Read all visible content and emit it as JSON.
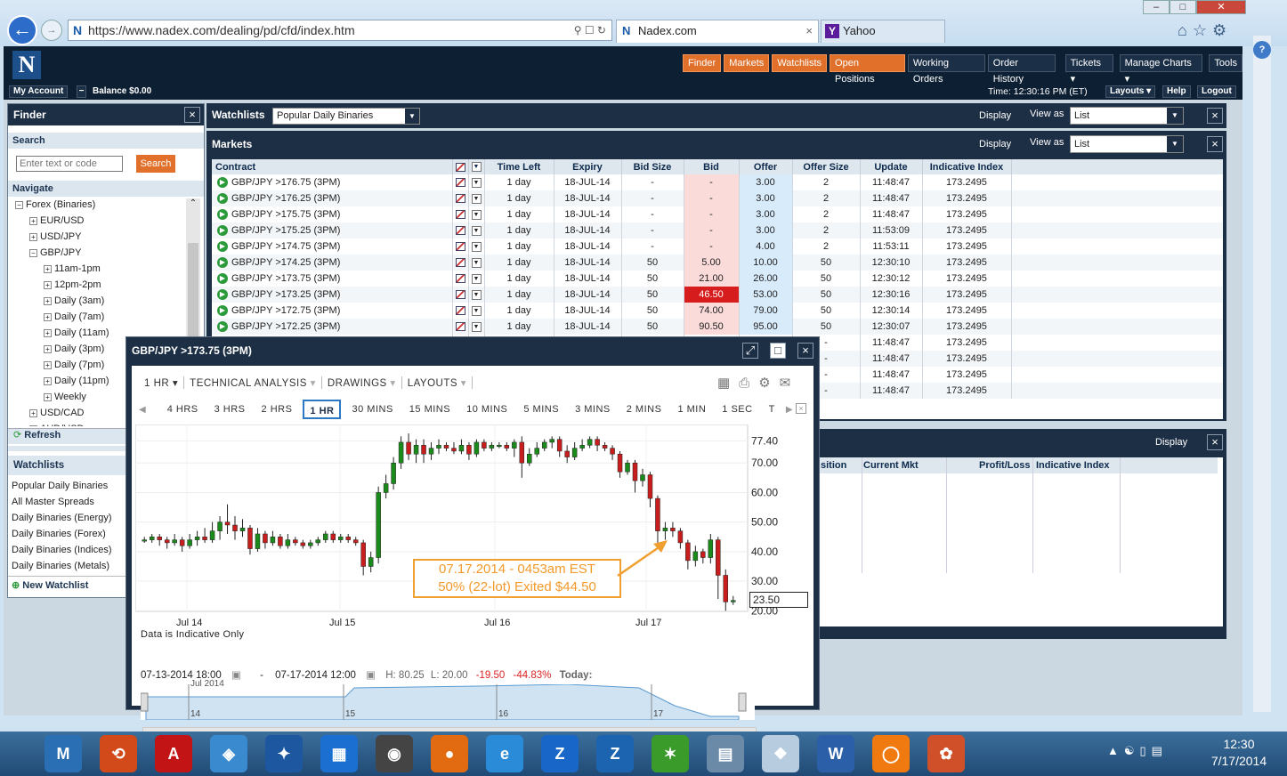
{
  "browser": {
    "url": "https://www.nadex.com/dealing/pd/cfd/index.htm",
    "tabs": [
      {
        "label": "Nadex.com"
      },
      {
        "label": "Yahoo"
      }
    ]
  },
  "toolbar": {
    "buttons": [
      "Finder",
      "Markets",
      "Watchlists",
      "Open Positions",
      "Working Orders",
      "Order History",
      "Tickets ▾",
      "Manage Charts ▾",
      "Tools"
    ],
    "my_account": "My Account",
    "balance": "Balance $0.00",
    "time": "Time: 12:30:16 PM (ET)",
    "layouts": "Layouts ▾",
    "help": "Help",
    "logout": "Logout"
  },
  "finder": {
    "title": "Finder",
    "search_label": "Search",
    "search_placeholder": "Enter text or code",
    "search_button": "Search",
    "navigate_label": "Navigate",
    "tree": [
      {
        "label": "Forex (Binaries)",
        "level": 0,
        "sign": "−"
      },
      {
        "label": "EUR/USD",
        "level": 1,
        "sign": "+"
      },
      {
        "label": "USD/JPY",
        "level": 1,
        "sign": "+"
      },
      {
        "label": "GBP/JPY",
        "level": 1,
        "sign": "−"
      },
      {
        "label": "11am-1pm",
        "level": 2,
        "sign": "+"
      },
      {
        "label": "12pm-2pm",
        "level": 2,
        "sign": "+"
      },
      {
        "label": "Daily (3am)",
        "level": 2,
        "sign": "+"
      },
      {
        "label": "Daily (7am)",
        "level": 2,
        "sign": "+"
      },
      {
        "label": "Daily (11am)",
        "level": 2,
        "sign": "+"
      },
      {
        "label": "Daily (3pm)",
        "level": 2,
        "sign": "+"
      },
      {
        "label": "Daily (7pm)",
        "level": 2,
        "sign": "+"
      },
      {
        "label": "Daily (11pm)",
        "level": 2,
        "sign": "+"
      },
      {
        "label": "Weekly",
        "level": 2,
        "sign": "+"
      },
      {
        "label": "USD/CAD",
        "level": 1,
        "sign": "+"
      },
      {
        "label": "AUD/USD",
        "level": 1,
        "sign": "+"
      }
    ],
    "refresh": "Refresh"
  },
  "watchlists_side": {
    "title": "Watchlists",
    "items": [
      "Popular Daily Binaries",
      "All Master Spreads",
      "Daily Binaries (Energy)",
      "Daily Binaries (Forex)",
      "Daily Binaries (Indices)",
      "Daily Binaries (Metals)"
    ],
    "new_label": "New Watchlist"
  },
  "watch_header": {
    "title": "Watchlists",
    "selected": "Popular Daily Binaries",
    "display": "Display",
    "view_as": "View as",
    "view_value": "List"
  },
  "markets": {
    "title": "Markets",
    "display": "Display",
    "view_as": "View as",
    "view_value": "List",
    "columns": [
      "Contract",
      "Time Left",
      "Expiry",
      "Bid Size",
      "Bid",
      "Offer",
      "Offer Size",
      "Update",
      "Indicative Index"
    ],
    "rows": [
      {
        "contract": "GBP/JPY >176.75 (3PM)",
        "time": "1 day",
        "expiry": "18-JUL-14",
        "bidsize": "-",
        "bid": "-",
        "offer": "3.00",
        "offersize": "2",
        "update": "11:48:47",
        "index": "173.2495"
      },
      {
        "contract": "GBP/JPY >176.25 (3PM)",
        "time": "1 day",
        "expiry": "18-JUL-14",
        "bidsize": "-",
        "bid": "-",
        "offer": "3.00",
        "offersize": "2",
        "update": "11:48:47",
        "index": "173.2495"
      },
      {
        "contract": "GBP/JPY >175.75 (3PM)",
        "time": "1 day",
        "expiry": "18-JUL-14",
        "bidsize": "-",
        "bid": "-",
        "offer": "3.00",
        "offersize": "2",
        "update": "11:48:47",
        "index": "173.2495"
      },
      {
        "contract": "GBP/JPY >175.25 (3PM)",
        "time": "1 day",
        "expiry": "18-JUL-14",
        "bidsize": "-",
        "bid": "-",
        "offer": "3.00",
        "offersize": "2",
        "update": "11:53:09",
        "index": "173.2495"
      },
      {
        "contract": "GBP/JPY >174.75 (3PM)",
        "time": "1 day",
        "expiry": "18-JUL-14",
        "bidsize": "-",
        "bid": "-",
        "offer": "4.00",
        "offersize": "2",
        "update": "11:53:11",
        "index": "173.2495"
      },
      {
        "contract": "GBP/JPY >174.25 (3PM)",
        "time": "1 day",
        "expiry": "18-JUL-14",
        "bidsize": "50",
        "bid": "5.00",
        "offer": "10.00",
        "offersize": "50",
        "update": "12:30:10",
        "index": "173.2495"
      },
      {
        "contract": "GBP/JPY >173.75 (3PM)",
        "time": "1 day",
        "expiry": "18-JUL-14",
        "bidsize": "50",
        "bid": "21.00",
        "offer": "26.00",
        "offersize": "50",
        "update": "12:30:12",
        "index": "173.2495"
      },
      {
        "contract": "GBP/JPY >173.25 (3PM)",
        "time": "1 day",
        "expiry": "18-JUL-14",
        "bidsize": "50",
        "bid": "46.50",
        "offer": "53.00",
        "offersize": "50",
        "update": "12:30:16",
        "index": "173.2495",
        "hot": true
      },
      {
        "contract": "GBP/JPY >172.75 (3PM)",
        "time": "1 day",
        "expiry": "18-JUL-14",
        "bidsize": "50",
        "bid": "74.00",
        "offer": "79.00",
        "offersize": "50",
        "update": "12:30:14",
        "index": "173.2495"
      },
      {
        "contract": "GBP/JPY >172.25 (3PM)",
        "time": "1 day",
        "expiry": "18-JUL-14",
        "bidsize": "50",
        "bid": "90.50",
        "offer": "95.00",
        "offersize": "50",
        "update": "12:30:07",
        "index": "173.2495"
      }
    ],
    "hidden_rows": [
      {
        "offersize": "-",
        "update": "11:48:47",
        "index": "173.2495"
      },
      {
        "offersize": "-",
        "update": "11:48:47",
        "index": "173.2495"
      },
      {
        "offersize": "-",
        "update": "11:48:47",
        "index": "173.2495"
      },
      {
        "offersize": "-",
        "update": "11:48:47",
        "index": "173.2495"
      }
    ]
  },
  "positions": {
    "display": "Display",
    "columns": [
      "sition",
      "Current Mkt",
      "Profit/Loss",
      "Indicative Index"
    ]
  },
  "popup": {
    "title": "GBP/JPY >173.75 (3PM)",
    "interval": "1 HR",
    "tech": "TECHNICAL ANALYSIS",
    "drawings": "DRAWINGS",
    "layouts": "LAYOUTS",
    "timeframes": [
      "4 HRS",
      "3 HRS",
      "2 HRS",
      "1 HR",
      "30 MINS",
      "15 MINS",
      "10 MINS",
      "5 MINS",
      "3 MINS",
      "2 MINS",
      "1 MIN",
      "1 SEC",
      "T"
    ],
    "selected_tf": "1 HR",
    "note": "Data is Indicative Only",
    "annotation_line1": "07.17.2014 - 0453am EST",
    "annotation_line2": "50% (22-lot) Exited $44.50",
    "last_price": "23.50",
    "date_from": "07-13-2014 18:00",
    "date_sep": "-",
    "date_to": "07-17-2014 12:00",
    "high": "H: 80.25",
    "low": "L: 20.00",
    "change": "-19.50",
    "change_pct": "-44.83%",
    "today": "Today:",
    "nav_month": "Jul 2014",
    "nav_days": [
      "14",
      "15",
      "16",
      "17"
    ]
  },
  "chart_data": {
    "type": "candlestick",
    "yticks": [
      "77.40",
      "70.00",
      "60.00",
      "50.00",
      "40.00",
      "30.00",
      "20.00"
    ],
    "ylim": [
      20,
      80.25
    ],
    "xticks": [
      "Jul 14",
      "Jul 15",
      "Jul 16",
      "Jul 17"
    ],
    "candles": [
      [
        44,
        44,
        43,
        45
      ],
      [
        44,
        45,
        43,
        46
      ],
      [
        45,
        44,
        42,
        46
      ],
      [
        44,
        43,
        41,
        45
      ],
      [
        43,
        44,
        42,
        46
      ],
      [
        44,
        42,
        40,
        45
      ],
      [
        42,
        44,
        41,
        46
      ],
      [
        44,
        45,
        42,
        47
      ],
      [
        45,
        44,
        43,
        48
      ],
      [
        44,
        47,
        43,
        50
      ],
      [
        47,
        50,
        44,
        52
      ],
      [
        50,
        49,
        46,
        56
      ],
      [
        49,
        47,
        44,
        52
      ],
      [
        47,
        48,
        45,
        51
      ],
      [
        48,
        41,
        39,
        49
      ],
      [
        41,
        46,
        40,
        48
      ],
      [
        46,
        43,
        41,
        47
      ],
      [
        43,
        45,
        42,
        47
      ],
      [
        45,
        42,
        41,
        46
      ],
      [
        42,
        44,
        41,
        46
      ],
      [
        44,
        43,
        42,
        45
      ],
      [
        43,
        42,
        41,
        44
      ],
      [
        42,
        43,
        41,
        44
      ],
      [
        43,
        44,
        42,
        45
      ],
      [
        44,
        46,
        43,
        47
      ],
      [
        46,
        44,
        43,
        47
      ],
      [
        44,
        45,
        43,
        46
      ],
      [
        45,
        44,
        43,
        46
      ],
      [
        44,
        43,
        42,
        45
      ],
      [
        43,
        35,
        32,
        44
      ],
      [
        35,
        38,
        33,
        40
      ],
      [
        38,
        60,
        36,
        62
      ],
      [
        60,
        63,
        58,
        66
      ],
      [
        63,
        70,
        61,
        72
      ],
      [
        70,
        77,
        68,
        79
      ],
      [
        77,
        73,
        71,
        80
      ],
      [
        73,
        76,
        70,
        78
      ],
      [
        76,
        73,
        70,
        78
      ],
      [
        73,
        75,
        71,
        77
      ],
      [
        75,
        76,
        73,
        78
      ],
      [
        76,
        75,
        74,
        77
      ],
      [
        75,
        74,
        73,
        77
      ],
      [
        74,
        76,
        73,
        78
      ],
      [
        76,
        73,
        71,
        77
      ],
      [
        73,
        77,
        72,
        78
      ],
      [
        77,
        75,
        74,
        78
      ],
      [
        75,
        76,
        74,
        77
      ],
      [
        76,
        76,
        75,
        77
      ],
      [
        76,
        75,
        74,
        77
      ],
      [
        75,
        77,
        72,
        78
      ],
      [
        77,
        70,
        65,
        79
      ],
      [
        70,
        73,
        69,
        75
      ],
      [
        73,
        75,
        72,
        77
      ],
      [
        75,
        77,
        74,
        78
      ],
      [
        77,
        78,
        75,
        79
      ],
      [
        78,
        74,
        72,
        79
      ],
      [
        74,
        72,
        70,
        76
      ],
      [
        72,
        75,
        71,
        77
      ],
      [
        75,
        76,
        74,
        78
      ],
      [
        76,
        78,
        75,
        79
      ],
      [
        78,
        76,
        74,
        79
      ],
      [
        76,
        75,
        74,
        77
      ],
      [
        75,
        73,
        71,
        76
      ],
      [
        73,
        67,
        65,
        74
      ],
      [
        67,
        70,
        66,
        71
      ],
      [
        70,
        64,
        60,
        71
      ],
      [
        64,
        66,
        62,
        68
      ],
      [
        66,
        58,
        55,
        67
      ],
      [
        58,
        47,
        43,
        59
      ],
      [
        47,
        48,
        44,
        50
      ],
      [
        48,
        47,
        45,
        50
      ],
      [
        47,
        43,
        41,
        48
      ],
      [
        43,
        37,
        34,
        44
      ],
      [
        37,
        40,
        35,
        42
      ],
      [
        40,
        38,
        36,
        41
      ],
      [
        38,
        44,
        36,
        46
      ],
      [
        44,
        32,
        24,
        45
      ],
      [
        32,
        23,
        20,
        34
      ],
      [
        23,
        23.5,
        22,
        25
      ]
    ]
  },
  "taskbar": {
    "time": "12:30",
    "date": "7/17/2014"
  }
}
